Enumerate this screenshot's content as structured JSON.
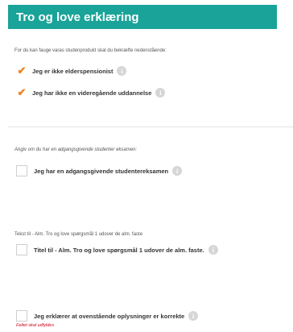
{
  "header": {
    "title": "Tro og love erklæring"
  },
  "intro": "For du kan fauge varas studenprodukt skal du bekræfte nedenstående:",
  "checked_items": [
    {
      "label": "Jeg er ikke elderspensionist"
    },
    {
      "label": "Jeg har ikke en videregående uddannelse"
    }
  ],
  "section2": {
    "prompt": "Angiv om du har en adgangsgivende studenter eksamen:",
    "option": "Jeg har en adgangsgivende studentereksamen"
  },
  "section3": {
    "prompt": "Tekst til - Alm. Tro og love spørgsmål 1 udover de alm. faste",
    "option": "Titel til - Alm. Tro og love spørgsmål 1 udover de alm. faste."
  },
  "section4": {
    "option": "Jeg erklærer at ovenstående oplysninger er korrekte",
    "error": "Feltet skal udfyldes"
  },
  "icons": {
    "info": "info-icon",
    "check": "checkmark-icon"
  },
  "colors": {
    "header_bg": "#1aa398",
    "check": "#f0821e",
    "error": "#d0021b"
  }
}
